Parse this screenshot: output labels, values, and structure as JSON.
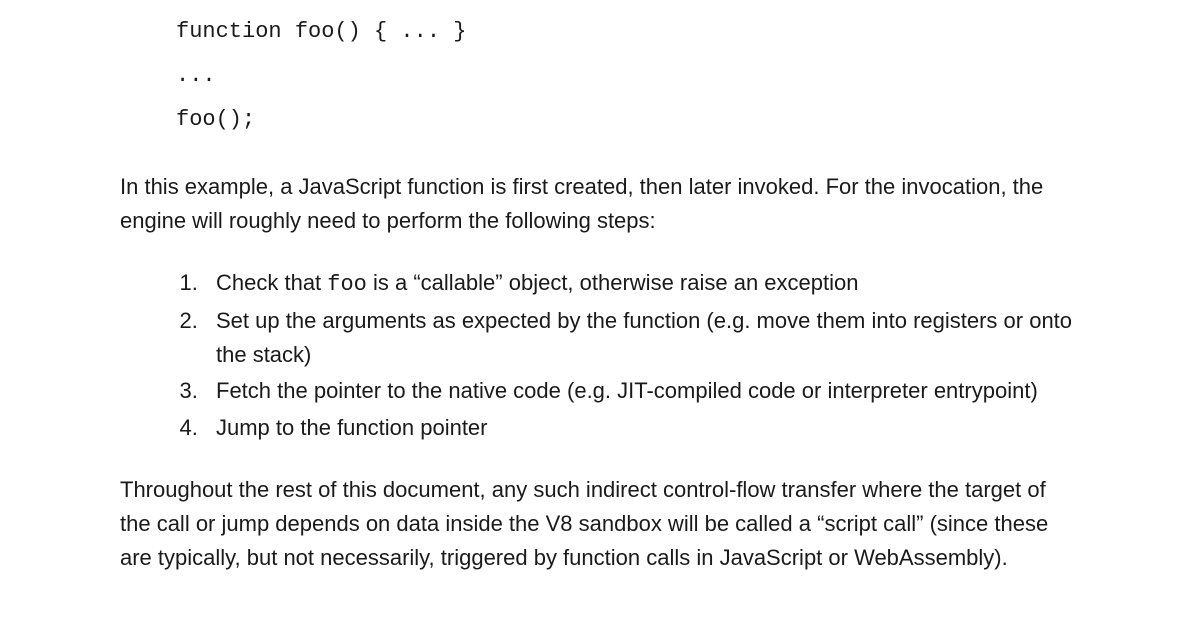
{
  "code": {
    "line1": "function foo() { ... }",
    "line2": "...",
    "line3": "foo();"
  },
  "para1": "In this example, a JavaScript function is first created, then later invoked. For the invocation, the engine will roughly need to perform the following steps:",
  "steps": {
    "s1_a": "Check that ",
    "s1_code": "foo",
    "s1_b": " is a “callable” object, otherwise raise an exception",
    "s2": "Set up the arguments as expected by the function (e.g. move them into registers or onto the stack)",
    "s3": "Fetch the pointer to the native code (e.g. JIT-compiled code or interpreter entrypoint)",
    "s4": "Jump to the function pointer"
  },
  "para2": "Throughout the rest of this document, any such indirect control-flow transfer where the target of the call or jump depends on data inside the V8 sandbox will be called a “script call” (since these are typically, but not necessarily, triggered by function calls in JavaScript or WebAssembly)."
}
